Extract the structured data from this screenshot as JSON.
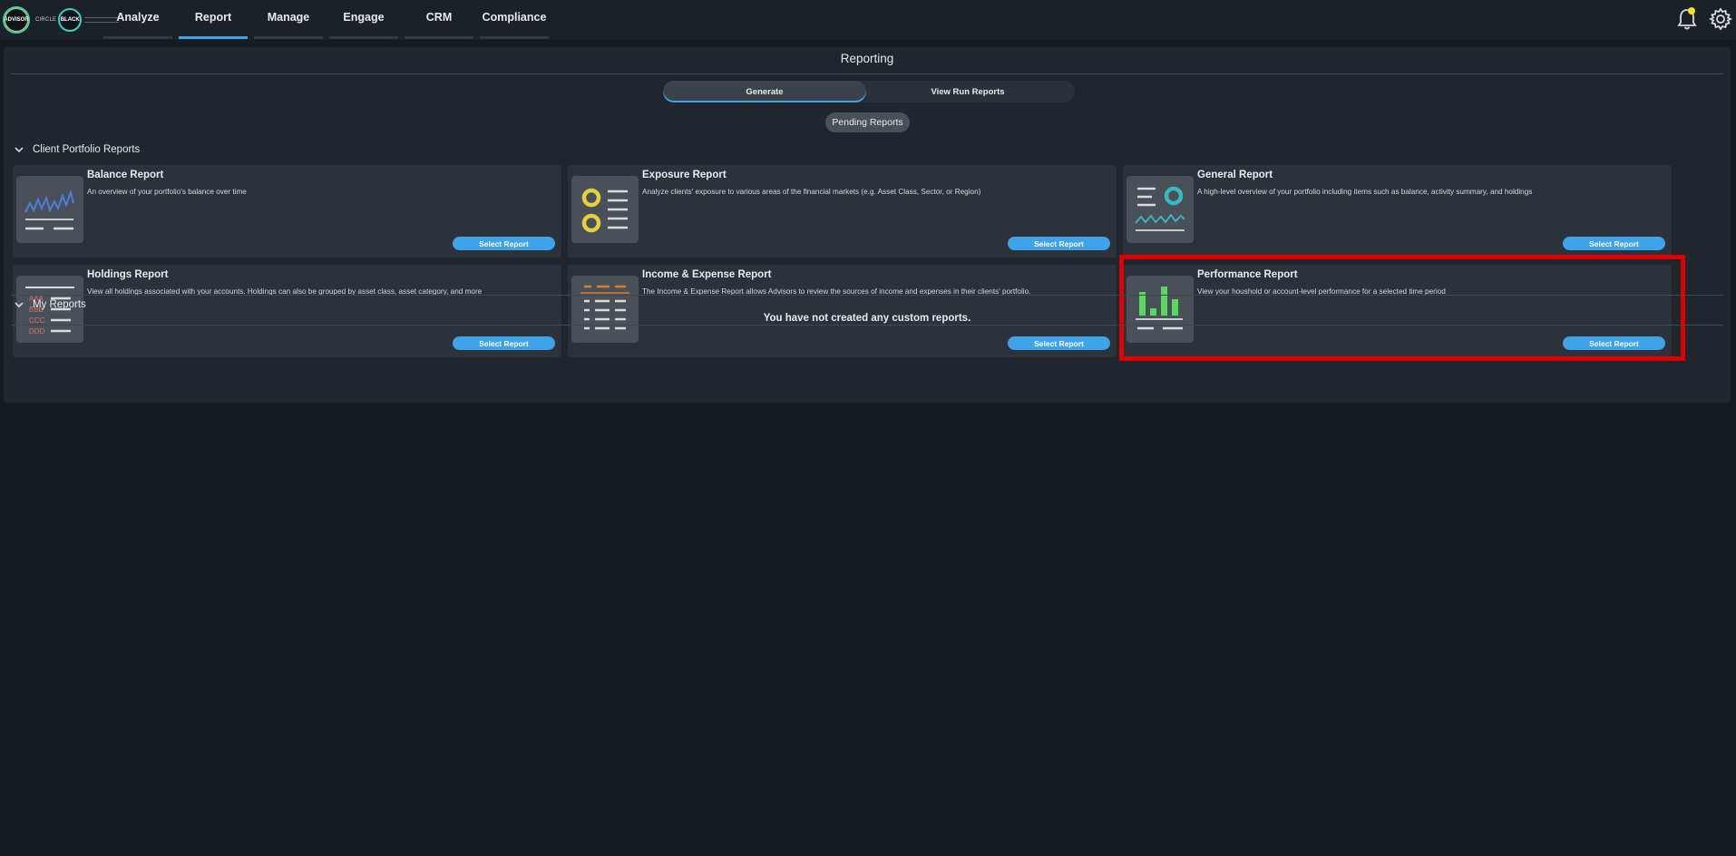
{
  "logo": {
    "left_badge": "ADVISOR",
    "middle_text": "CIRCLE",
    "right_badge": "BLACK"
  },
  "nav": [
    {
      "label": "Analyze",
      "active": false
    },
    {
      "label": "Report",
      "active": true
    },
    {
      "label": "Manage",
      "active": false
    },
    {
      "label": "Engage",
      "active": false
    },
    {
      "label": "CRM",
      "active": false
    },
    {
      "label": "Compliance",
      "active": false
    }
  ],
  "header_icons": {
    "bell": "bell-icon",
    "gear": "gear-icon",
    "notification_dot_color": "#f5e11e"
  },
  "page": {
    "title": "Reporting",
    "tabs": [
      {
        "label": "Generate",
        "active": true
      },
      {
        "label": "View Run Reports",
        "active": false
      }
    ],
    "pending_label": "Pending Reports"
  },
  "sections": {
    "client_portfolio": {
      "label": "Client Portfolio Reports"
    },
    "my_reports": {
      "label": "My Reports",
      "empty_message": "You have not created any custom reports."
    }
  },
  "cards": [
    {
      "title": "Balance Report",
      "description": "An overview of your portfolio's balance over time",
      "button": "Select Report",
      "icon": "line-chart-icon"
    },
    {
      "title": "Exposure Report",
      "description": "Analyze clients' exposure to various areas of the financial markets (e.g. Asset Class, Sector, or Region)",
      "button": "Select Report",
      "icon": "list-bullets-icon"
    },
    {
      "title": "General Report",
      "description": "A high-level overview of your portfolio including items such as balance, activity summary, and holdings",
      "button": "Select Report",
      "icon": "summary-icon"
    },
    {
      "title": "Holdings Report",
      "description": "View all holdings associated with your accounts. Holdings can also be grouped by asset class, asset category, and more",
      "button": "Select Report",
      "icon": "holdings-list-icon",
      "icon_labels": [
        "AAA",
        "BBB",
        "CCC",
        "DDD"
      ]
    },
    {
      "title": "Income & Expense Report",
      "description": "The Income & Expense Report allows Advisors to review the sources of income and expenses in their clients' portfolio.",
      "button": "Select Report",
      "icon": "ledger-icon"
    },
    {
      "title": "Performance Report",
      "description": "View your houshold or account-level performance for a selected time period",
      "button": "Select Report",
      "icon": "bar-chart-icon",
      "highlighted": true
    }
  ],
  "colors": {
    "accent": "#3ea3e8",
    "highlight": "#e00000",
    "icon_yellow": "#e3d23a",
    "icon_teal": "#3ab8c4",
    "icon_green": "#5bd85f",
    "icon_orange": "#e07a2c"
  }
}
